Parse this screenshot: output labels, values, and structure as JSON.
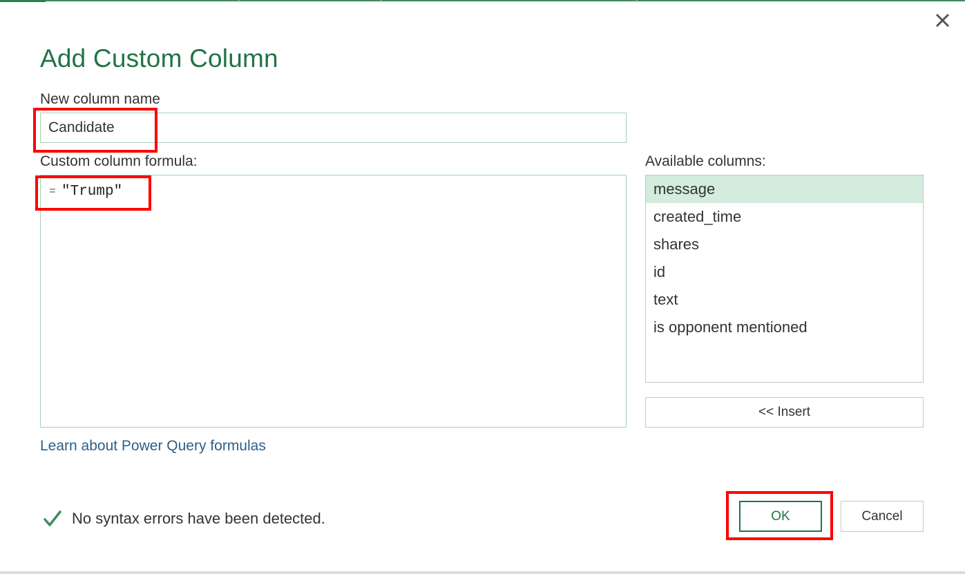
{
  "dialog": {
    "title": "Add Custom Column",
    "close_icon": "close-icon"
  },
  "new_column": {
    "label": "New column name",
    "value": "Candidate"
  },
  "formula": {
    "label": "Custom column formula:",
    "prefix": "=",
    "value": "\"Trump\""
  },
  "available_columns": {
    "label": "Available columns:",
    "items": [
      {
        "label": "message",
        "selected": true
      },
      {
        "label": "created_time",
        "selected": false
      },
      {
        "label": "shares",
        "selected": false
      },
      {
        "label": "id",
        "selected": false
      },
      {
        "label": "text",
        "selected": false
      },
      {
        "label": "is opponent mentioned",
        "selected": false
      }
    ],
    "insert_label": "<< Insert"
  },
  "learn_link": "Learn about Power Query formulas",
  "status": {
    "icon": "checkmark-icon",
    "text": "No syntax errors have been detected."
  },
  "buttons": {
    "ok": "OK",
    "cancel": "Cancel"
  },
  "colors": {
    "accent_green": "#217346",
    "selected_row": "#d3ecdd",
    "link_blue": "#2a5f8a",
    "highlight_red": "#ff0000"
  }
}
